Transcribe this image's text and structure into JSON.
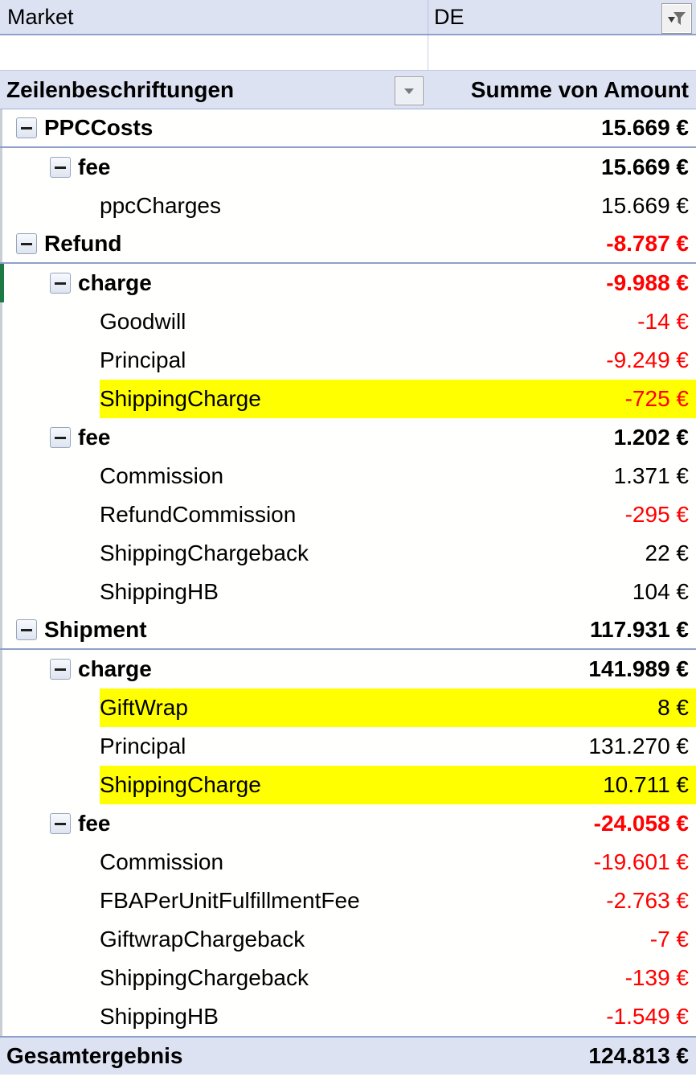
{
  "report": {
    "filter": {
      "field_label": "Market",
      "selected_value": "DE",
      "filter_icon": "funnel-filter-icon"
    },
    "columns": {
      "row_labels_header": "Zeilenbeschriftungen",
      "row_labels_dropdown_icon": "chevron-down-icon",
      "value_header": "Summe von Amount"
    },
    "rows": [
      {
        "id": "ppccosts",
        "label": "PPCCosts",
        "value": "15.669 €",
        "level": 0,
        "bold": true,
        "negative": false,
        "expanded": true,
        "highlight": false,
        "marker": "none",
        "sep_bottom": true
      },
      {
        "id": "ppc-fee",
        "label": "fee",
        "value": "15.669 €",
        "level": 1,
        "bold": true,
        "negative": false,
        "expanded": true,
        "highlight": false,
        "marker": "none",
        "sep_bottom": false
      },
      {
        "id": "ppccharges",
        "label": "ppcCharges",
        "value": "15.669 €",
        "level": 2,
        "bold": false,
        "negative": false,
        "expanded": false,
        "highlight": false,
        "marker": "none",
        "sep_bottom": false
      },
      {
        "id": "refund",
        "label": "Refund",
        "value": "-8.787 €",
        "level": 0,
        "bold": true,
        "negative": true,
        "expanded": true,
        "highlight": false,
        "marker": "none",
        "sep_bottom": true
      },
      {
        "id": "refund-charge",
        "label": "charge",
        "value": "-9.988 €",
        "level": 1,
        "bold": true,
        "negative": true,
        "expanded": true,
        "highlight": false,
        "marker": "green",
        "sep_bottom": false
      },
      {
        "id": "goodwill",
        "label": "Goodwill",
        "value": "-14 €",
        "level": 2,
        "bold": false,
        "negative": true,
        "expanded": false,
        "highlight": false,
        "marker": "none",
        "sep_bottom": false
      },
      {
        "id": "refund-princ",
        "label": "Principal",
        "value": "-9.249 €",
        "level": 2,
        "bold": false,
        "negative": true,
        "expanded": false,
        "highlight": false,
        "marker": "none",
        "sep_bottom": false
      },
      {
        "id": "refund-shipchg",
        "label": "ShippingCharge",
        "value": "-725 €",
        "level": 2,
        "bold": false,
        "negative": true,
        "expanded": false,
        "highlight": true,
        "marker": "none",
        "sep_bottom": false
      },
      {
        "id": "refund-fee",
        "label": "fee",
        "value": "1.202 €",
        "level": 1,
        "bold": true,
        "negative": false,
        "expanded": true,
        "highlight": false,
        "marker": "none",
        "sep_bottom": false
      },
      {
        "id": "refund-comm",
        "label": "Commission",
        "value": "1.371 €",
        "level": 2,
        "bold": false,
        "negative": false,
        "expanded": false,
        "highlight": false,
        "marker": "none",
        "sep_bottom": false
      },
      {
        "id": "refundcomm",
        "label": "RefundCommission",
        "value": "-295 €",
        "level": 2,
        "bold": false,
        "negative": true,
        "expanded": false,
        "highlight": false,
        "marker": "none",
        "sep_bottom": false
      },
      {
        "id": "refund-shipcb",
        "label": "ShippingChargeback",
        "value": "22 €",
        "level": 2,
        "bold": false,
        "negative": false,
        "expanded": false,
        "highlight": false,
        "marker": "none",
        "sep_bottom": false
      },
      {
        "id": "refund-shiphb",
        "label": "ShippingHB",
        "value": "104 €",
        "level": 2,
        "bold": false,
        "negative": false,
        "expanded": false,
        "highlight": false,
        "marker": "none",
        "sep_bottom": false
      },
      {
        "id": "shipment",
        "label": "Shipment",
        "value": "117.931 €",
        "level": 0,
        "bold": true,
        "negative": false,
        "expanded": true,
        "highlight": false,
        "marker": "none",
        "sep_bottom": true
      },
      {
        "id": "ship-charge",
        "label": "charge",
        "value": "141.989 €",
        "level": 1,
        "bold": true,
        "negative": false,
        "expanded": true,
        "highlight": false,
        "marker": "none",
        "sep_bottom": false
      },
      {
        "id": "giftwrap",
        "label": "GiftWrap",
        "value": "8 €",
        "level": 2,
        "bold": false,
        "negative": false,
        "expanded": false,
        "highlight": true,
        "marker": "none",
        "sep_bottom": false
      },
      {
        "id": "ship-princ",
        "label": "Principal",
        "value": "131.270 €",
        "level": 2,
        "bold": false,
        "negative": false,
        "expanded": false,
        "highlight": false,
        "marker": "none",
        "sep_bottom": false
      },
      {
        "id": "ship-shipchg",
        "label": "ShippingCharge",
        "value": "10.711 €",
        "level": 2,
        "bold": false,
        "negative": false,
        "expanded": false,
        "highlight": true,
        "marker": "none",
        "sep_bottom": false
      },
      {
        "id": "ship-fee",
        "label": "fee",
        "value": "-24.058 €",
        "level": 1,
        "bold": true,
        "negative": true,
        "expanded": true,
        "highlight": false,
        "marker": "none",
        "sep_bottom": false
      },
      {
        "id": "ship-comm",
        "label": "Commission",
        "value": "-19.601 €",
        "level": 2,
        "bold": false,
        "negative": true,
        "expanded": false,
        "highlight": false,
        "marker": "none",
        "sep_bottom": false
      },
      {
        "id": "fba-fee",
        "label": "FBAPerUnitFulfillmentFee",
        "value": "-2.763 €",
        "level": 2,
        "bold": false,
        "negative": true,
        "expanded": false,
        "highlight": false,
        "marker": "none",
        "sep_bottom": false
      },
      {
        "id": "giftwrap-cb",
        "label": "GiftwrapChargeback",
        "value": "-7 €",
        "level": 2,
        "bold": false,
        "negative": true,
        "expanded": false,
        "highlight": false,
        "marker": "none",
        "sep_bottom": false
      },
      {
        "id": "ship-shipcb",
        "label": "ShippingChargeback",
        "value": "-139 €",
        "level": 2,
        "bold": false,
        "negative": true,
        "expanded": false,
        "highlight": false,
        "marker": "none",
        "sep_bottom": false
      },
      {
        "id": "ship-shiphb",
        "label": "ShippingHB",
        "value": "-1.549 €",
        "level": 2,
        "bold": false,
        "negative": true,
        "expanded": false,
        "highlight": false,
        "marker": "none",
        "sep_bottom": false
      }
    ],
    "grand_total": {
      "label": "Gesamtergebnis",
      "value": "124.813 €"
    },
    "colors": {
      "header_background": "#DDE2F2",
      "highlight_yellow": "#FFFF00",
      "negative_red": "#FF0000",
      "grid_blue": "#8EA0CC",
      "change_marker_green": "#1D7A45"
    }
  }
}
